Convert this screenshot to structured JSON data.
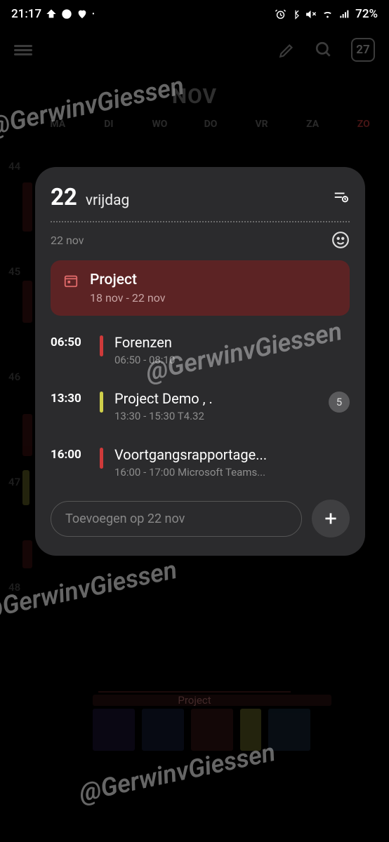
{
  "status": {
    "time": "21:17",
    "battery": "72%"
  },
  "toolbar": {
    "today_date": "27"
  },
  "month": {
    "title": "NOV",
    "weekdays": [
      "MA",
      "DI",
      "WO",
      "DO",
      "VR",
      "ZA",
      "ZO"
    ],
    "week_numbers": [
      "44",
      "45",
      "46",
      "47",
      "48"
    ]
  },
  "panel": {
    "day_number": "22",
    "day_name": "vrijdag",
    "date_short": "22 nov",
    "allday": {
      "title": "Project",
      "range": "18 nov - 22 nov"
    },
    "events": [
      {
        "time": "06:50",
        "color": "#cf3a3a",
        "title": "Forenzen",
        "sub": "06:50 - 08:10",
        "badge": ""
      },
      {
        "time": "13:30",
        "color": "#cfcf4a",
        "title": "Project Demo , .",
        "sub": "13:30 - 15:30  T4.32",
        "badge": "5"
      },
      {
        "time": "16:00",
        "color": "#cf3a3a",
        "title": "Voortgangsrapportage...",
        "sub": "16:00 - 17:00  Microsoft Teams...",
        "badge": ""
      }
    ],
    "add_placeholder": "Toevoegen op 22 nov"
  },
  "bottom_label": "Project",
  "watermark": "@GerwinvGiessen"
}
